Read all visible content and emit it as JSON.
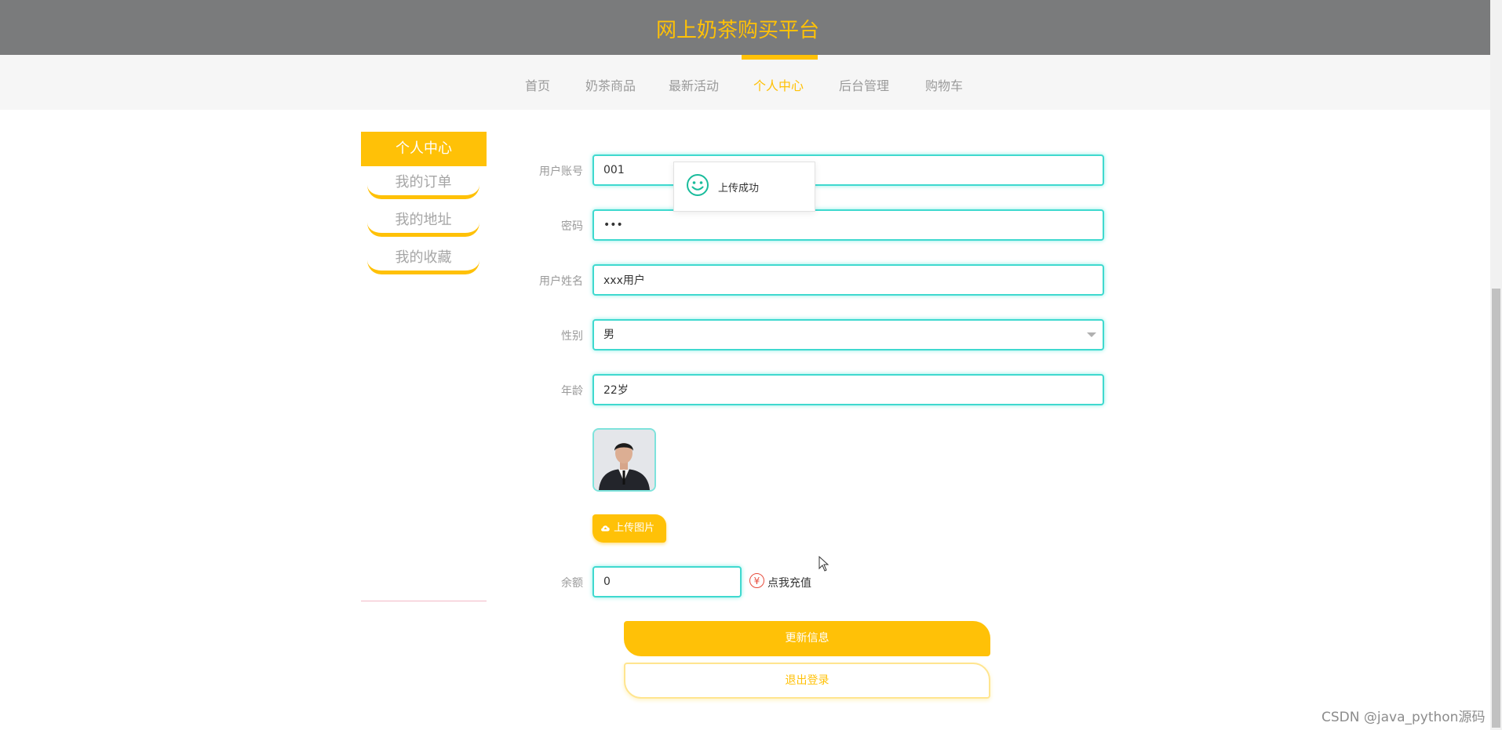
{
  "header": {
    "title": "网上奶茶购买平台"
  },
  "nav": {
    "items": [
      {
        "label": "首页"
      },
      {
        "label": "奶茶商品"
      },
      {
        "label": "最新活动"
      },
      {
        "label": "个人中心"
      },
      {
        "label": "后台管理"
      },
      {
        "label": "购物车"
      }
    ],
    "active_index": 3
  },
  "sidebar": {
    "title": "个人中心",
    "items": [
      {
        "label": "我的订单"
      },
      {
        "label": "我的地址"
      },
      {
        "label": "我的收藏"
      }
    ]
  },
  "form": {
    "account": {
      "label": "用户账号",
      "value": "001"
    },
    "password": {
      "label": "密码",
      "value": "•••"
    },
    "name": {
      "label": "用户姓名",
      "value": "xxx用户"
    },
    "gender": {
      "label": "性别",
      "value": "男"
    },
    "age": {
      "label": "年龄",
      "value": "22岁"
    },
    "upload_label": "上传图片",
    "balance": {
      "label": "余额",
      "value": "0"
    },
    "recharge_label": "点我充值",
    "update_label": "更新信息",
    "logout_label": "退出登录"
  },
  "toast": {
    "message": "上传成功"
  },
  "watermark": "CSDN @java_python源码",
  "colors": {
    "accent": "#ffc107",
    "input_border": "#3fd9cf",
    "header_bg": "#7a7b7c"
  }
}
